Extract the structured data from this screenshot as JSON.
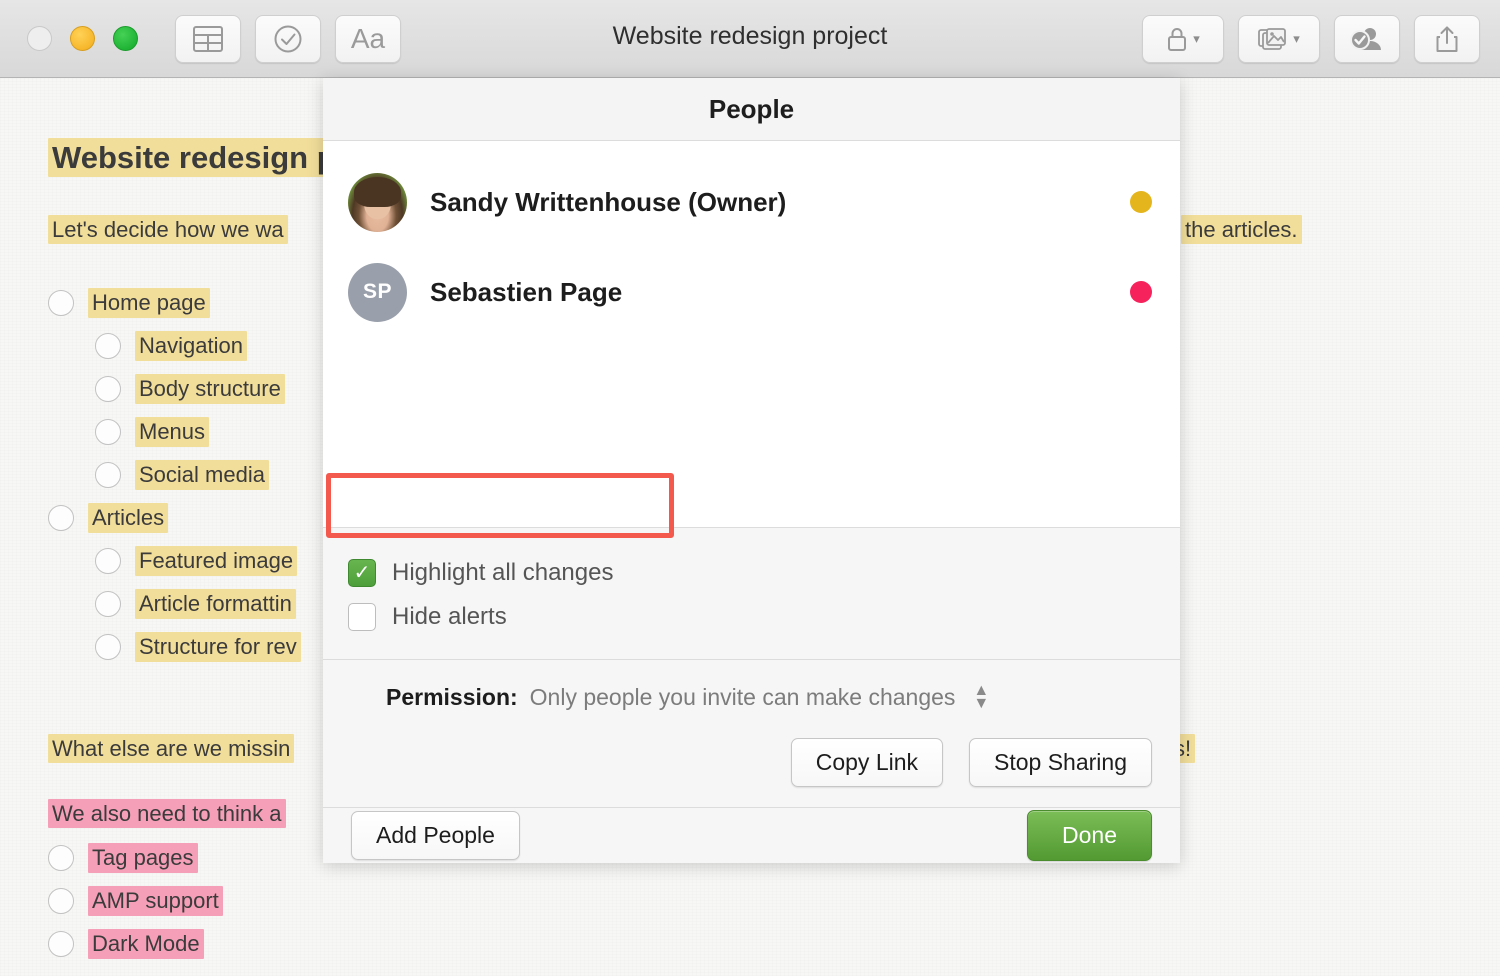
{
  "window": {
    "title": "Website redesign project",
    "traffic_lights": [
      "close",
      "minimize",
      "maximize"
    ],
    "toolbar_left": [
      {
        "name": "table-button",
        "icon": "table-icon"
      },
      {
        "name": "checklist-button",
        "icon": "check-circle-icon"
      },
      {
        "name": "format-button",
        "icon": "Aa"
      }
    ],
    "toolbar_right": [
      {
        "name": "lock-button",
        "icon": "lock-icon",
        "has_chevron": true
      },
      {
        "name": "media-button",
        "icon": "photos-icon",
        "has_chevron": true
      },
      {
        "name": "collaborate-button",
        "icon": "person-check-icon",
        "has_chevron": false
      },
      {
        "name": "share-button",
        "icon": "share-icon",
        "has_chevron": false
      }
    ]
  },
  "document": {
    "title": "Website redesign",
    "title_full": "Website redesign project",
    "paragraph_1": "Let's decide how we wa",
    "paragraph_1_right": "the articles.",
    "paragraph_2": "What else are we missin",
    "paragraph_2_right": "s!",
    "paragraph_3": "We also need to think a",
    "checklist_1": [
      {
        "label": "Home page",
        "indent": false,
        "checked": false,
        "highlight": "yellow"
      },
      {
        "label": "Navigation",
        "indent": true,
        "checked": false,
        "highlight": "yellow"
      },
      {
        "label": "Body structure",
        "indent": true,
        "checked": false,
        "highlight": "yellow"
      },
      {
        "label": "Menus",
        "indent": true,
        "checked": false,
        "highlight": "yellow"
      },
      {
        "label": "Social media",
        "indent": true,
        "checked": false,
        "highlight": "yellow"
      },
      {
        "label": "Articles",
        "indent": false,
        "checked": false,
        "highlight": "yellow"
      },
      {
        "label": "Featured image",
        "indent": true,
        "checked": false,
        "highlight": "yellow"
      },
      {
        "label": "Article formattin",
        "indent": true,
        "checked": false,
        "highlight": "yellow"
      },
      {
        "label": "Structure for rev",
        "indent": true,
        "checked": false,
        "highlight": "yellow"
      }
    ],
    "checklist_2": [
      {
        "label": "Tag pages",
        "indent": false,
        "checked": false,
        "highlight": "pink"
      },
      {
        "label": "AMP support",
        "indent": false,
        "checked": false,
        "highlight": "pink"
      },
      {
        "label": "Dark Mode",
        "indent": false,
        "checked": false,
        "highlight": "pink"
      }
    ],
    "highlight_yellow": "#f2de9b",
    "highlight_pink": "#f5a0b8"
  },
  "dialog": {
    "title": "People",
    "people": [
      {
        "name": "Sandy Writtenhouse (Owner)",
        "avatar_type": "photo",
        "initials": "",
        "status_color": "#e5b51e"
      },
      {
        "name": "Sebastien Page",
        "avatar_type": "initials",
        "initials": "SP",
        "status_color": "#f5225c"
      }
    ],
    "options": [
      {
        "label": "Highlight all changes",
        "checked": true
      },
      {
        "label": "Hide alerts",
        "checked": false
      }
    ],
    "permission": {
      "label": "Permission:",
      "value": "Only people you invite can make changes"
    },
    "buttons": {
      "copy_link": "Copy Link",
      "stop_sharing": "Stop Sharing",
      "add_people": "Add People",
      "done": "Done"
    },
    "checkbox_on_color": "#4e9f3c",
    "done_color": "#539a33"
  },
  "annotation": {
    "border_color": "#f4594e",
    "target": "Highlight all changes"
  }
}
